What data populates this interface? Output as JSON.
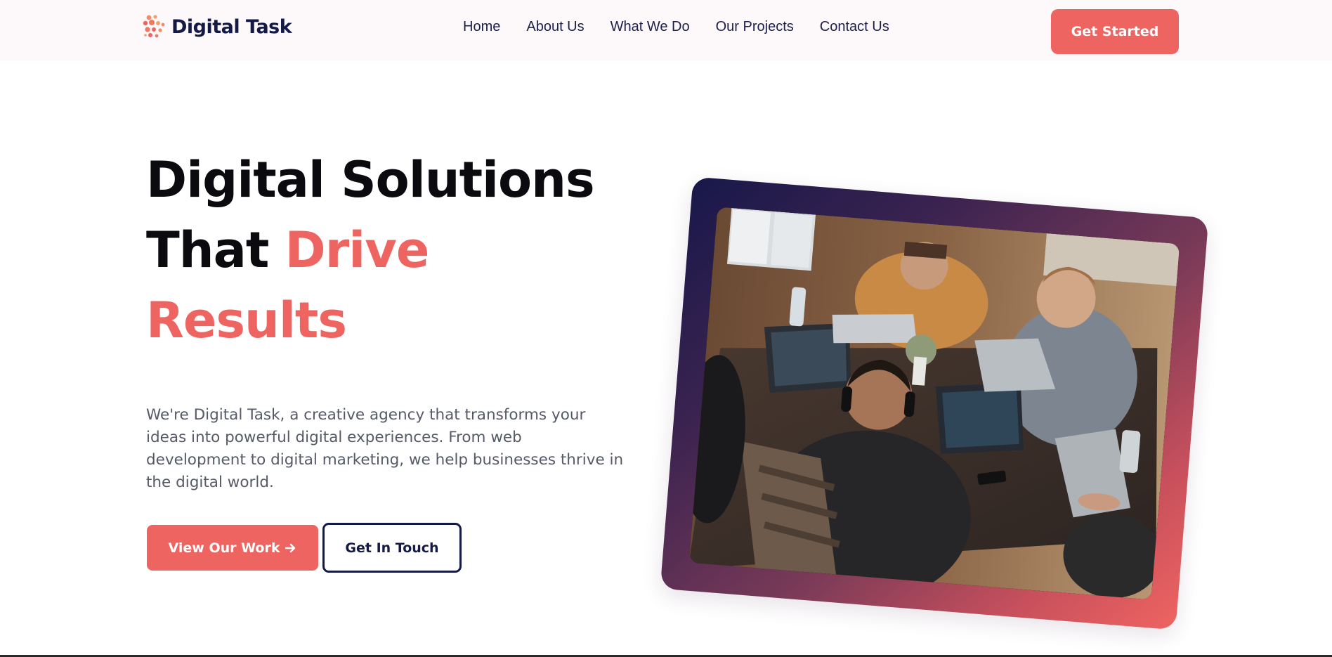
{
  "brand": {
    "name": "Digital Task",
    "logo_icon": "dots-cluster-logo-icon",
    "accent_color": "#ee6461",
    "dark_color": "#141a45"
  },
  "nav": {
    "links": [
      "Home",
      "About Us",
      "What We Do",
      "Our Projects",
      "Contact Us"
    ],
    "cta_label": "Get Started"
  },
  "hero": {
    "title_line1": "Digital Solutions",
    "title_line2_plain": "That ",
    "title_line2_accent": "Drive",
    "title_line3_accent": "Results",
    "description": "We're Digital Task, a creative agency that transforms your ideas into powerful digital experiences. From web development to digital marketing, we help businesses thrive in the digital world.",
    "primary_button": "View Our Work",
    "primary_button_icon": "arrow-right-icon",
    "secondary_button": "Get In Touch",
    "image_subject": "team-working-on-laptops-photo"
  }
}
